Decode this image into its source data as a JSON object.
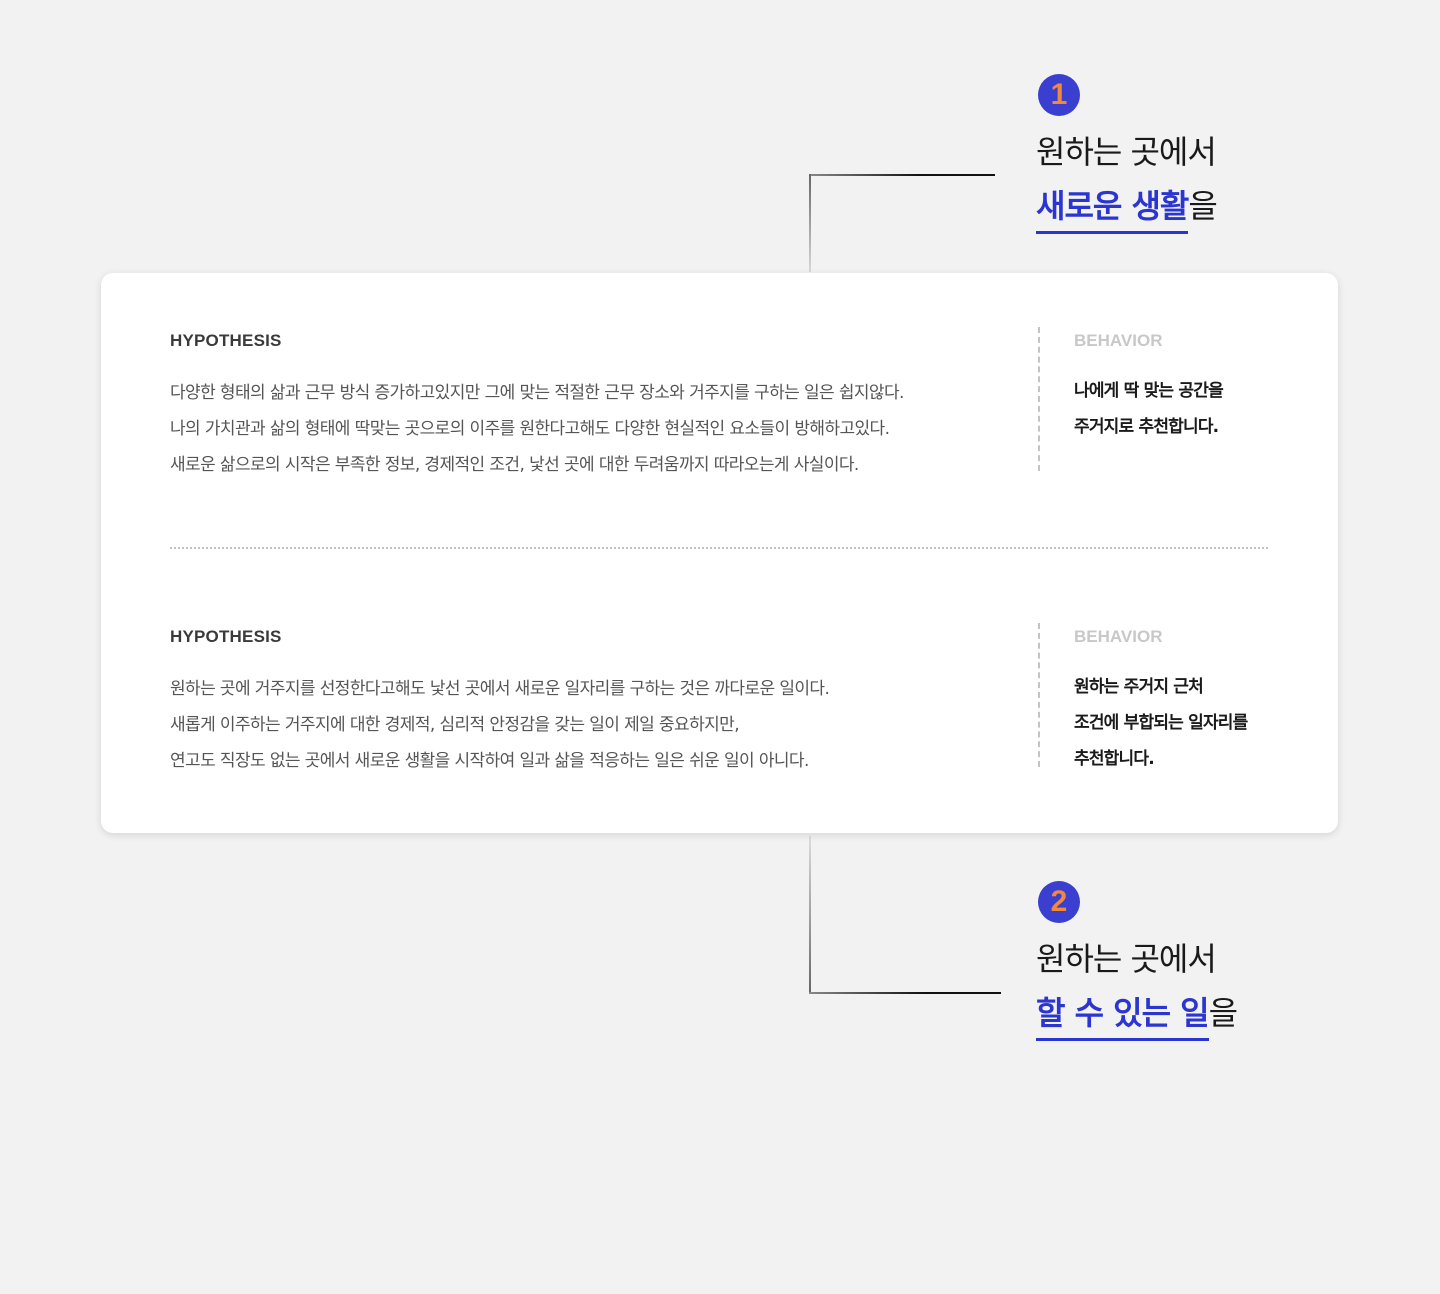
{
  "callouts": [
    {
      "number": "1",
      "line1": "원하는 곳에서",
      "highlight": "새로운 생활",
      "suffix": "을"
    },
    {
      "number": "2",
      "line1": "원하는 곳에서",
      "highlight": "할 수 있는 일",
      "suffix": "을"
    }
  ],
  "sections": [
    {
      "hypothesis_label": "HYPOTHESIS",
      "hypothesis_lines": [
        "다양한 형태의 삶과 근무 방식 증가하고있지만 그에 맞는 적절한 근무 장소와 거주지를 구하는 일은 쉽지않다.",
        "나의 가치관과 삶의 형태에 딱맞는 곳으로의 이주를 원한다고해도 다양한 현실적인 요소들이 방해하고있다.",
        "새로운 삶으로의 시작은 부족한 정보, 경제적인 조건, 낯선 곳에 대한 두려움까지 따라오는게 사실이다."
      ],
      "behavior_label": "BEHAVIOR",
      "behavior_lines": [
        "나에게 딱 맞는 공간을",
        "주거지로 추천합니다."
      ]
    },
    {
      "hypothesis_label": "HYPOTHESIS",
      "hypothesis_lines": [
        "원하는 곳에 거주지를 선정한다고해도 낯선 곳에서 새로운 일자리를 구하는 것은 까다로운 일이다.",
        "새롭게 이주하는 거주지에 대한 경제적, 심리적 안정감을 갖는 일이 제일 중요하지만,",
        "연고도 직장도 없는 곳에서 새로운 생활을 시작하여 일과 삶을 적응하는 일은 쉬운 일이 아니다."
      ],
      "behavior_label": "BEHAVIOR",
      "behavior_lines": [
        "원하는 주거지 근처",
        "조건에 부합되는 일자리를",
        "추천합니다."
      ]
    }
  ],
  "colors": {
    "accent_blue": "#2b35d0",
    "badge_bg": "#3a3fcf",
    "badge_number": "#f2883a",
    "background": "#f2f2f2"
  }
}
